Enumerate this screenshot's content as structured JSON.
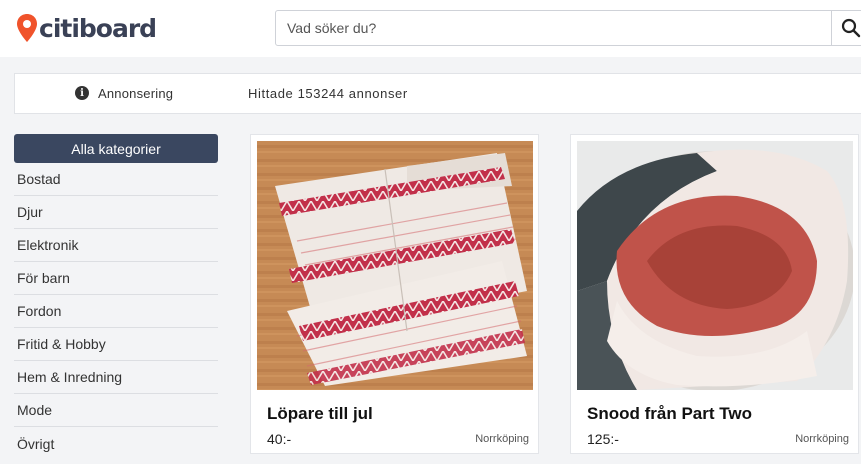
{
  "header": {
    "logo_text": "citiboard",
    "search_placeholder": "Vad söker du?"
  },
  "infobar": {
    "ad_label": "Annonsering",
    "results_text": "Hittade 153244 annonser"
  },
  "sidebar": {
    "all_categories_label": "Alla kategorier",
    "items": [
      {
        "label": "Bostad"
      },
      {
        "label": "Djur"
      },
      {
        "label": "Elektronik"
      },
      {
        "label": "För barn"
      },
      {
        "label": "Fordon"
      },
      {
        "label": "Fritid & Hobby"
      },
      {
        "label": "Hem & Inredning"
      },
      {
        "label": "Mode"
      },
      {
        "label": "Övrigt"
      }
    ]
  },
  "listings": [
    {
      "title": "Löpare till jul",
      "price": "40:-",
      "location": "Norrköping",
      "image": "woven-table-runner-photo"
    },
    {
      "title": "Snood från Part Two",
      "price": "125:-",
      "location": "Norrköping",
      "image": "knitted-snood-photo"
    }
  ],
  "colors": {
    "brand_dark": "#3a4156",
    "brand_pin": "#f0532b",
    "category_button": "#3a4760"
  }
}
